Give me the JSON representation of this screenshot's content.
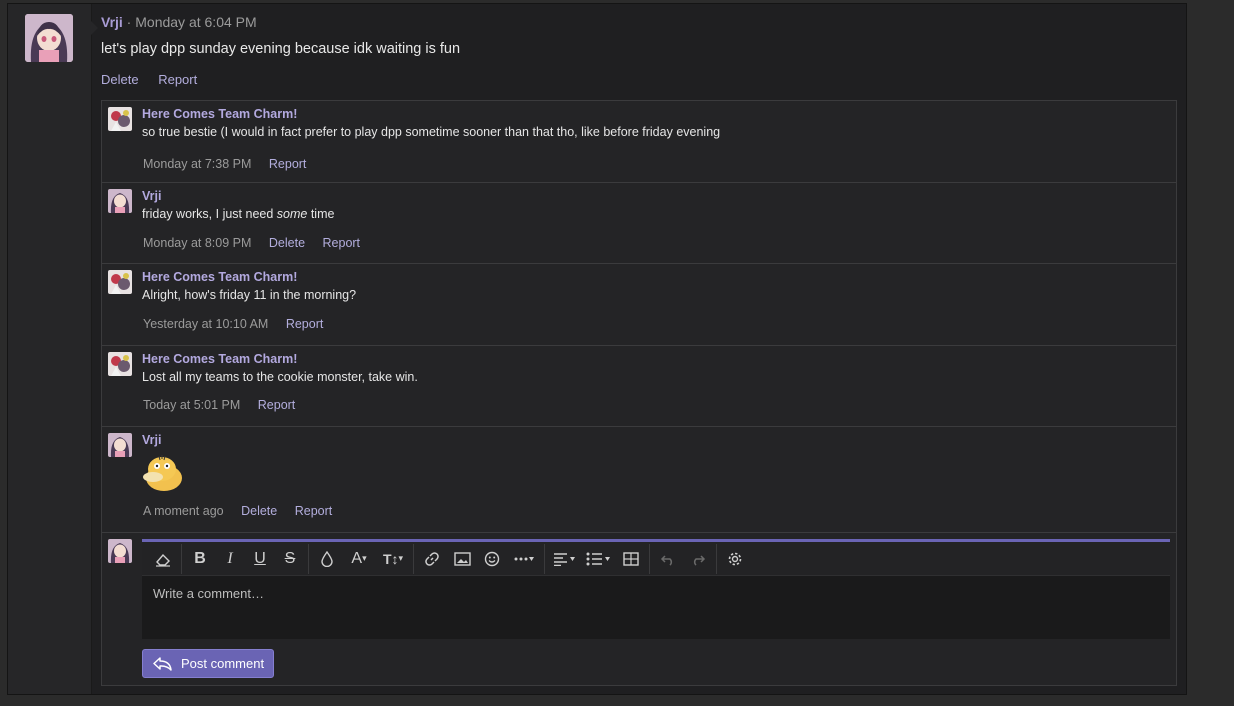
{
  "post": {
    "author": "Vrji",
    "separator": " · ",
    "time": "Monday at 6:04 PM",
    "text": "let's play dpp sunday evening because idk waiting is fun",
    "actions": [
      "Delete",
      "Report"
    ]
  },
  "comments": [
    {
      "author": "Here Comes Team Charm!",
      "text": "so true bestie (I would in fact prefer to play dpp sometime sooner than that tho, like before friday evening",
      "time": "Monday at 7:38 PM",
      "actions": [
        "Report"
      ]
    },
    {
      "author": "Vrji",
      "text_before": "friday works, I just need ",
      "text_italic": "some",
      "text_after": " time",
      "time": "Monday at 8:09 PM",
      "actions": [
        "Delete",
        "Report"
      ]
    },
    {
      "author": "Here Comes Team Charm!",
      "text": "Alright, how's friday 11 in the morning?",
      "time": "Yesterday at 10:10 AM",
      "actions": [
        "Report"
      ]
    },
    {
      "author": "Here Comes Team Charm!",
      "text": "Lost all my teams to the cookie monster, take win.",
      "time": "Today at 5:01 PM",
      "actions": [
        "Report"
      ]
    },
    {
      "author": "Vrji",
      "emoji": "psyduck-emoji",
      "time": "A moment ago",
      "actions": [
        "Delete",
        "Report"
      ]
    }
  ],
  "editor": {
    "placeholder": "Write a comment…",
    "post_label": "Post comment",
    "toolbar_icons": [
      "eraser-icon",
      "bold-icon",
      "italic-icon",
      "underline-icon",
      "strikethrough-icon",
      "color-drop-icon",
      "font-family-icon",
      "font-size-icon",
      "link-icon",
      "image-icon",
      "smiley-icon",
      "more-icon",
      "align-icon",
      "list-icon",
      "table-icon",
      "undo-icon",
      "redo-icon",
      "gear-icon"
    ],
    "toolbar_glyphs": {
      "bold": "B",
      "italic": "I",
      "underline": "U",
      "strike": "S",
      "font": "A",
      "size": "T↕"
    }
  },
  "colors": {
    "accent": "#6a64b4",
    "username": "#a89bd4",
    "link": "#b3aedd"
  }
}
